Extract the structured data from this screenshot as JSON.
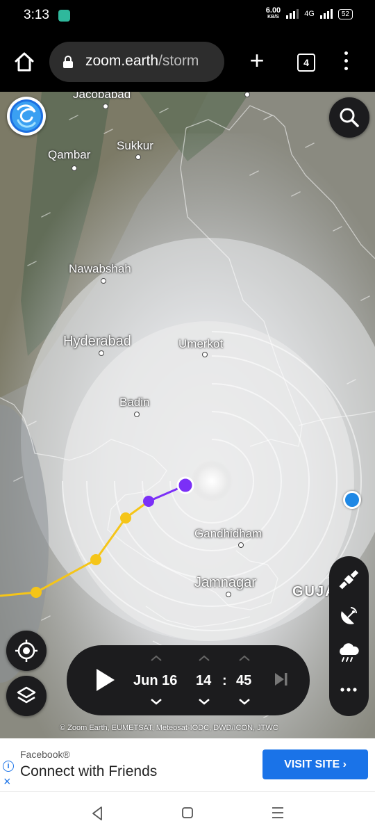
{
  "status_bar": {
    "time": "3:13",
    "net_speed": "6.00",
    "net_unit": "KB/S",
    "network": "4G",
    "battery": "52"
  },
  "browser": {
    "url_host": "zoom.earth",
    "url_path": "/storm",
    "tab_count": "4",
    "new_tab_symbol": "+"
  },
  "map": {
    "cities": {
      "jacobabad": "Jacobabad",
      "qambar": "Qambar",
      "sukkur": "Sukkur",
      "nawabshah": "Nawabshah",
      "hyderabad": "Hyderabad",
      "umerkot": "Umerkot",
      "badin": "Badin",
      "gandhidham": "Gandhidham",
      "jamnagar": "Jamnagar",
      "gujarat": "GUJA"
    },
    "track_colors": {
      "past": "#f5c518",
      "forecast": "#7b2ff7"
    },
    "attribution": "© Zoom Earth, EUMETSAT, Meteosat-IODC, DWD/ICON, JTWC"
  },
  "timeline": {
    "date": "Jun 16",
    "hour": "14",
    "separator": ":",
    "minute": "45"
  },
  "ad": {
    "source": "Facebook®",
    "title": "Connect with Friends",
    "button": "VISIT SITE",
    "info": "i",
    "close": "×"
  },
  "icons": {
    "home": "home-icon",
    "lock": "lock-icon",
    "search": "search-icon",
    "locate": "crosshair-icon",
    "layers": "layers-icon",
    "satellite": "satellite-icon",
    "radar": "radar-icon",
    "rain": "rain-cloud-icon",
    "more": "more-icon"
  }
}
